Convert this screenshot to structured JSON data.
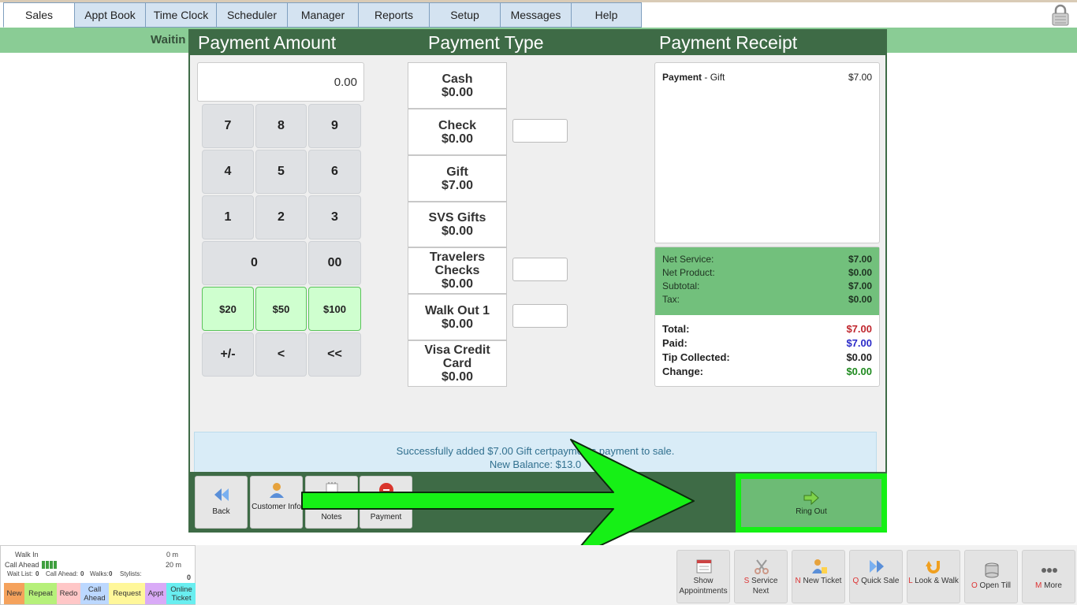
{
  "tabs": [
    "Sales",
    "Appt Book",
    "Time Clock",
    "Scheduler",
    "Manager",
    "Reports",
    "Setup",
    "Messages",
    "Help"
  ],
  "waiting_label": "Waitin",
  "modal": {
    "headers": {
      "amount": "Payment Amount",
      "type": "Payment Type",
      "receipt": "Payment Receipt"
    },
    "amount_value": "0.00",
    "keypad": [
      "7",
      "8",
      "9",
      "4",
      "5",
      "6",
      "1",
      "2",
      "3",
      "0",
      "00",
      "$20",
      "$50",
      "$100",
      "+/-",
      "<",
      "<<"
    ],
    "payment_types": [
      {
        "name": "Cash",
        "amount": "$0.00"
      },
      {
        "name": "Check",
        "amount": "$0.00"
      },
      {
        "name": "Gift",
        "amount": "$7.00"
      },
      {
        "name": "SVS Gifts",
        "amount": "$0.00"
      },
      {
        "name": "Travelers Checks",
        "amount": "$0.00"
      },
      {
        "name": "Walk Out 1",
        "amount": "$0.00"
      },
      {
        "name": "Visa Credit Card",
        "amount": "$0.00"
      }
    ],
    "receipt": {
      "line_label": "Payment",
      "line_type": "- Gift",
      "line_amount": "$7.00",
      "net_service_label": "Net Service:",
      "net_service": "$7.00",
      "net_product_label": "Net Product:",
      "net_product": "$0.00",
      "subtotal_label": "Subtotal:",
      "subtotal": "$7.00",
      "tax_label": "Tax:",
      "tax": "$0.00",
      "total_label": "Total:",
      "total": "$7.00",
      "paid_label": "Paid:",
      "paid": "$7.00",
      "tip_label": "Tip Collected:",
      "tip": "$0.00",
      "change_label": "Change:",
      "change": "$0.00"
    },
    "message_line1": "Successfully added $7.00 Gift certpayments payment to sale.",
    "message_line2": "New Balance: $13.0",
    "footer_buttons": {
      "back": "Back",
      "customer_info": "Customer Info",
      "notes": "Notes",
      "payment": "Payment",
      "ring_out": "Ring Out"
    }
  },
  "queue": {
    "walk_in_label": "Walk In",
    "walk_in_time": "0 m",
    "call_ahead_label": "Call Ahead",
    "call_ahead_time": "20 m",
    "wait_list": "Wait List:",
    "wait_list_n": "0",
    "call_ahead2": "Call Ahead:",
    "call_ahead2_n": "0",
    "walks": "Walks:",
    "walks_n": "0",
    "stylists": "Stylists:",
    "stylists_n": "0",
    "legend": [
      "New",
      "Repeat",
      "Redo",
      "Call Ahead",
      "Request",
      "Appt",
      "Online Ticket"
    ]
  },
  "bottom_buttons": [
    {
      "key": "",
      "label": "Show Appointments"
    },
    {
      "key": "S",
      "label": "Service Next"
    },
    {
      "key": "N",
      "label": "New Ticket"
    },
    {
      "key": "Q",
      "label": "Quick Sale"
    },
    {
      "key": "L",
      "label": "Look & Walk"
    },
    {
      "key": "O",
      "label": "Open Till"
    },
    {
      "key": "M",
      "label": "More"
    }
  ],
  "colors": {
    "accent_green": "#3e6b46",
    "light_green": "#8acc95",
    "highlight": "#14f014",
    "total_red": "#c0262d",
    "paid_blue": "#2a2ac8",
    "change_green": "#1f8a1f"
  }
}
